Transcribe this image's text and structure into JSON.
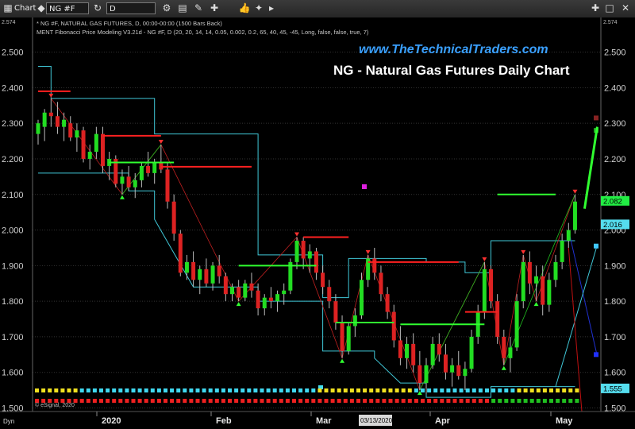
{
  "toolbar": {
    "title": "Chart",
    "symbol": "NG #F",
    "interval": "D",
    "icons": [
      "chart-window-icon",
      "link-icon",
      "refresh-icon",
      "settings-icon",
      "layout-icon",
      "draw-icon",
      "crosshair-icon",
      "thumbs-up-icon",
      "twitter-icon",
      "pin-icon",
      "maximize-icon",
      "close-icon"
    ]
  },
  "study_lines": [
    "* NG #F, NATURAL GAS FUTURES, D, 00:00-00:00 (1500 Bars Back)",
    "MENT Fibonacci Price Modeling V3.21d - NG #F, D (20, 20, 14, 14, 0.05, 0.002, 0.2, 65, 40, 45, -45, Long, false, false, true, 7)"
  ],
  "watermark": "www.TheTechnicalTraders.com",
  "title": "NG - Natural Gas Futures Daily Chart",
  "footer_left": "Dyn",
  "copyright": "© eSignal, 2020",
  "date_flag": "03/13/2020",
  "colors": {
    "background": "#000000",
    "up": "#22dd22",
    "down": "#dd2222",
    "channel": "#40c8d8",
    "fib_red": "#ff2020",
    "fib_green": "#30ff30",
    "grid": "#333333"
  },
  "chart_data": {
    "type": "candlestick",
    "title": "NG - Natural Gas Futures Daily Chart",
    "ylim": [
      1.49,
      2.575
    ],
    "y_ticks": [
      "2.500",
      "2.400",
      "2.300",
      "2.200",
      "2.100",
      "2.000",
      "1.900",
      "1.800",
      "1.700",
      "1.600",
      "1.500"
    ],
    "top_value_left": "2.574",
    "top_value_right": "2.574",
    "x_labels": [
      "2020",
      "Feb",
      "Mar",
      "Apr",
      "May"
    ],
    "price_tags": [
      {
        "value": 2.082,
        "label": "2.082",
        "color": "#22ee44"
      },
      {
        "value": 2.016,
        "label": "2.016",
        "color": "#55ddee"
      },
      {
        "value": 1.555,
        "label": "1.555",
        "color": "#55ddee"
      }
    ],
    "ohlc": [
      [
        2.27,
        2.31,
        2.24,
        2.3
      ],
      [
        2.29,
        2.34,
        2.25,
        2.33
      ],
      [
        2.33,
        2.37,
        2.29,
        2.32
      ],
      [
        2.32,
        2.36,
        2.27,
        2.29
      ],
      [
        2.29,
        2.33,
        2.25,
        2.31
      ],
      [
        2.3,
        2.32,
        2.25,
        2.26
      ],
      [
        2.26,
        2.3,
        2.22,
        2.28
      ],
      [
        2.28,
        2.29,
        2.19,
        2.2
      ],
      [
        2.2,
        2.24,
        2.17,
        2.22
      ],
      [
        2.22,
        2.29,
        2.2,
        2.27
      ],
      [
        2.27,
        2.29,
        2.16,
        2.18
      ],
      [
        2.18,
        2.22,
        2.14,
        2.2
      ],
      [
        2.2,
        2.21,
        2.12,
        2.13
      ],
      [
        2.13,
        2.17,
        2.1,
        2.15
      ],
      [
        2.15,
        2.18,
        2.11,
        2.12
      ],
      [
        2.12,
        2.16,
        2.09,
        2.14
      ],
      [
        2.14,
        2.19,
        2.12,
        2.18
      ],
      [
        2.18,
        2.22,
        2.15,
        2.16
      ],
      [
        2.16,
        2.2,
        2.13,
        2.19
      ],
      [
        2.19,
        2.24,
        2.16,
        2.17
      ],
      [
        2.17,
        2.19,
        2.06,
        2.08
      ],
      [
        2.08,
        2.1,
        1.97,
        1.99
      ],
      [
        1.99,
        2.0,
        1.87,
        1.88
      ],
      [
        1.88,
        1.93,
        1.86,
        1.91
      ],
      [
        1.91,
        1.94,
        1.84,
        1.86
      ],
      [
        1.86,
        1.9,
        1.82,
        1.89
      ],
      [
        1.89,
        1.92,
        1.84,
        1.85
      ],
      [
        1.85,
        1.91,
        1.83,
        1.9
      ],
      [
        1.9,
        1.93,
        1.85,
        1.87
      ],
      [
        1.87,
        1.88,
        1.8,
        1.82
      ],
      [
        1.82,
        1.85,
        1.8,
        1.84
      ],
      [
        1.84,
        1.86,
        1.8,
        1.81
      ],
      [
        1.81,
        1.86,
        1.8,
        1.85
      ],
      [
        1.85,
        1.88,
        1.81,
        1.83
      ],
      [
        1.83,
        1.85,
        1.76,
        1.78
      ],
      [
        1.78,
        1.82,
        1.76,
        1.81
      ],
      [
        1.81,
        1.84,
        1.78,
        1.8
      ],
      [
        1.8,
        1.83,
        1.77,
        1.82
      ],
      [
        1.82,
        1.85,
        1.79,
        1.83
      ],
      [
        1.83,
        1.92,
        1.82,
        1.91
      ],
      [
        1.91,
        1.98,
        1.89,
        1.97
      ],
      [
        1.97,
        1.98,
        1.89,
        1.92
      ],
      [
        1.92,
        1.96,
        1.88,
        1.94
      ],
      [
        1.94,
        1.95,
        1.86,
        1.88
      ],
      [
        1.88,
        1.9,
        1.82,
        1.84
      ],
      [
        1.84,
        1.86,
        1.78,
        1.8
      ],
      [
        1.8,
        1.82,
        1.72,
        1.74
      ],
      [
        1.74,
        1.76,
        1.64,
        1.66
      ],
      [
        1.66,
        1.74,
        1.65,
        1.73
      ],
      [
        1.73,
        1.78,
        1.7,
        1.76
      ],
      [
        1.76,
        1.88,
        1.75,
        1.86
      ],
      [
        1.86,
        1.93,
        1.84,
        1.92
      ],
      [
        1.92,
        1.95,
        1.86,
        1.88
      ],
      [
        1.88,
        1.9,
        1.8,
        1.82
      ],
      [
        1.82,
        1.84,
        1.75,
        1.77
      ],
      [
        1.77,
        1.79,
        1.67,
        1.69
      ],
      [
        1.69,
        1.73,
        1.62,
        1.64
      ],
      [
        1.64,
        1.7,
        1.61,
        1.68
      ],
      [
        1.68,
        1.71,
        1.6,
        1.62
      ],
      [
        1.62,
        1.66,
        1.55,
        1.57
      ],
      [
        1.57,
        1.64,
        1.54,
        1.62
      ],
      [
        1.62,
        1.7,
        1.61,
        1.68
      ],
      [
        1.68,
        1.71,
        1.63,
        1.65
      ],
      [
        1.65,
        1.68,
        1.58,
        1.6
      ],
      [
        1.6,
        1.64,
        1.56,
        1.62
      ],
      [
        1.62,
        1.66,
        1.58,
        1.59
      ],
      [
        1.59,
        1.63,
        1.55,
        1.61
      ],
      [
        1.61,
        1.72,
        1.6,
        1.7
      ],
      [
        1.7,
        1.79,
        1.68,
        1.77
      ],
      [
        1.77,
        1.91,
        1.75,
        1.89
      ],
      [
        1.89,
        1.9,
        1.78,
        1.8
      ],
      [
        1.8,
        1.82,
        1.68,
        1.7
      ],
      [
        1.7,
        1.72,
        1.62,
        1.64
      ],
      [
        1.64,
        1.7,
        1.6,
        1.67
      ],
      [
        1.67,
        1.82,
        1.66,
        1.8
      ],
      [
        1.8,
        1.93,
        1.78,
        1.91
      ],
      [
        1.91,
        1.94,
        1.82,
        1.85
      ],
      [
        1.85,
        1.9,
        1.8,
        1.87
      ],
      [
        1.87,
        1.9,
        1.76,
        1.79
      ],
      [
        1.79,
        1.88,
        1.77,
        1.86
      ],
      [
        1.86,
        1.93,
        1.84,
        1.91
      ],
      [
        1.91,
        1.99,
        1.89,
        1.97
      ],
      [
        1.97,
        2.02,
        1.95,
        2.0
      ],
      [
        2.0,
        2.1,
        1.99,
        2.08
      ]
    ],
    "forecast": [
      [
        2.06,
        2.29
      ]
    ],
    "fib_red_levels": [
      {
        "y": 2.39,
        "x0": 0,
        "x1": 5
      },
      {
        "y": 2.265,
        "x0": 10,
        "x1": 19
      },
      {
        "y": 2.178,
        "x0": 19,
        "x1": 33
      },
      {
        "y": 1.98,
        "x0": 41,
        "x1": 48
      },
      {
        "y": 1.91,
        "x0": 51,
        "x1": 65
      },
      {
        "y": 1.77,
        "x0": 66,
        "x1": 71
      }
    ],
    "fib_green_levels": [
      {
        "y": 2.19,
        "x0": 11,
        "x1": 21
      },
      {
        "y": 1.9,
        "x0": 31,
        "x1": 43
      },
      {
        "y": 1.74,
        "x0": 46,
        "x1": 55
      },
      {
        "y": 1.735,
        "x0": 56,
        "x1": 69
      },
      {
        "y": 2.1,
        "x0": 71,
        "x1": 80
      }
    ],
    "channel_upper": [
      [
        0,
        2.46
      ],
      [
        2,
        2.46
      ],
      [
        2,
        2.37
      ],
      [
        18,
        2.37
      ],
      [
        18,
        2.27
      ],
      [
        34,
        2.27
      ],
      [
        34,
        1.93
      ],
      [
        44,
        1.93
      ],
      [
        44,
        1.81
      ],
      [
        48,
        1.81
      ],
      [
        48,
        1.92
      ],
      [
        60,
        1.92
      ],
      [
        60,
        1.91
      ],
      [
        66,
        1.91
      ],
      [
        66,
        1.88
      ],
      [
        70,
        1.88
      ],
      [
        70,
        1.97
      ],
      [
        83,
        1.97
      ]
    ],
    "channel_lower": [
      [
        0,
        2.16
      ],
      [
        14,
        2.16
      ],
      [
        14,
        2.11
      ],
      [
        18,
        2.11
      ],
      [
        18,
        2.03
      ],
      [
        24,
        1.84
      ],
      [
        34,
        1.84
      ],
      [
        34,
        1.8
      ],
      [
        44,
        1.8
      ],
      [
        44,
        1.66
      ],
      [
        52,
        1.66
      ],
      [
        52,
        1.64
      ],
      [
        56,
        1.57
      ],
      [
        60,
        1.57
      ],
      [
        60,
        1.53
      ],
      [
        70,
        1.53
      ],
      [
        70,
        1.56
      ],
      [
        83,
        1.56
      ]
    ]
  }
}
